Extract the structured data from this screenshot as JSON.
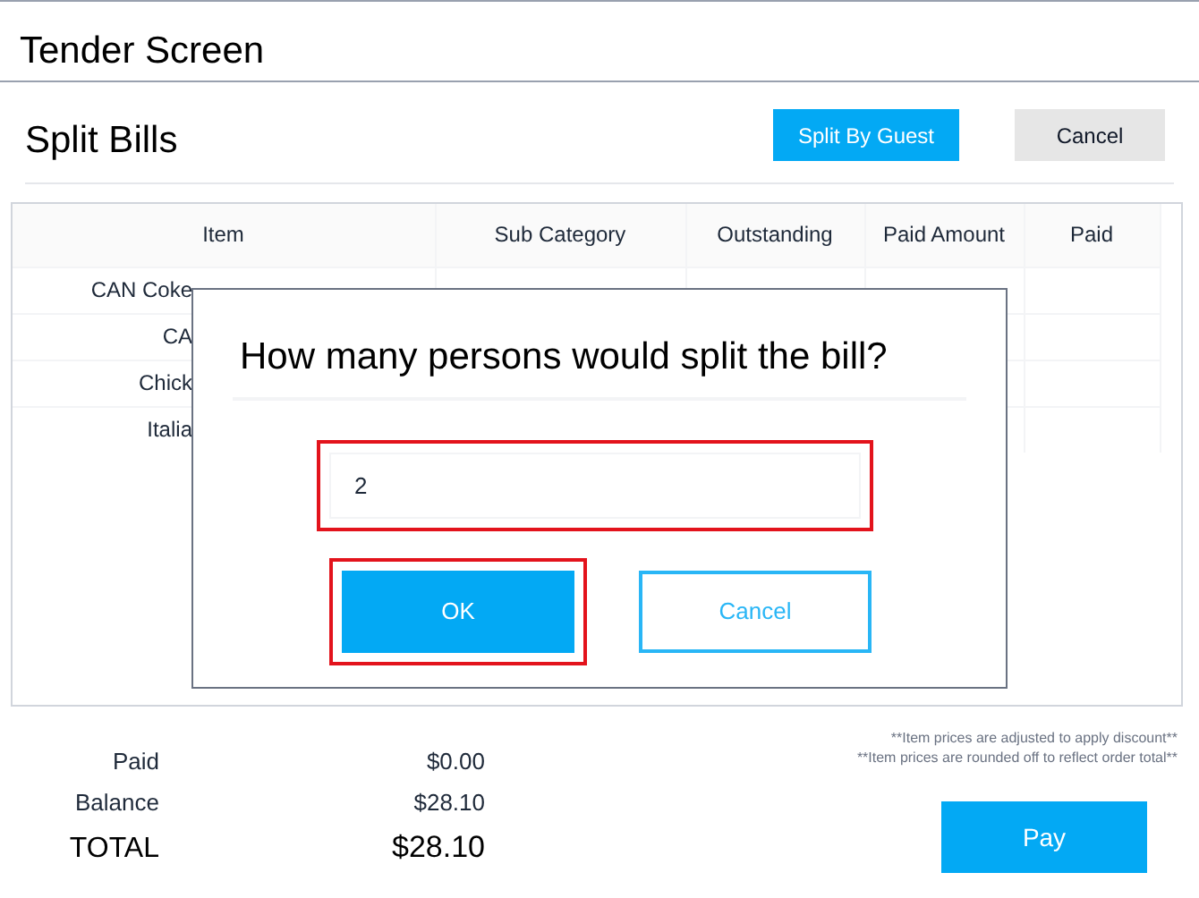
{
  "window": {
    "title": "Tender Screen"
  },
  "header": {
    "title": "Split Bills",
    "buttons": [
      {
        "label": "Split By Guest",
        "kind": "primary"
      },
      {
        "label": "Cancel",
        "kind": "secondary"
      }
    ]
  },
  "table": {
    "columns": [
      "Item",
      "Sub Category",
      "Outstanding",
      "Paid Amount",
      "Paid"
    ],
    "rows": [
      [
        "CAN Coke"
      ],
      [
        "CA"
      ],
      [
        "Chick"
      ],
      [
        "Italia"
      ]
    ]
  },
  "dialog": {
    "title": "How many persons would split the bill?",
    "field": {
      "value": "2",
      "highlighted": true
    },
    "buttons": [
      {
        "label": "OK",
        "kind": "primary",
        "highlighted": true
      },
      {
        "label": "Cancel",
        "kind": "outline",
        "highlighted": false
      }
    ]
  },
  "summary": [
    {
      "label": "Paid",
      "value": "$0.00",
      "emphasis": false
    },
    {
      "label": "Balance",
      "value": "$28.10",
      "emphasis": false
    },
    {
      "label": "TOTAL",
      "value": "$28.10",
      "emphasis": true
    }
  ],
  "notes": [
    "**Item prices are adjusted to apply discount**",
    "**Item prices are rounded off to reflect order total**"
  ],
  "pay_button": "Pay"
}
